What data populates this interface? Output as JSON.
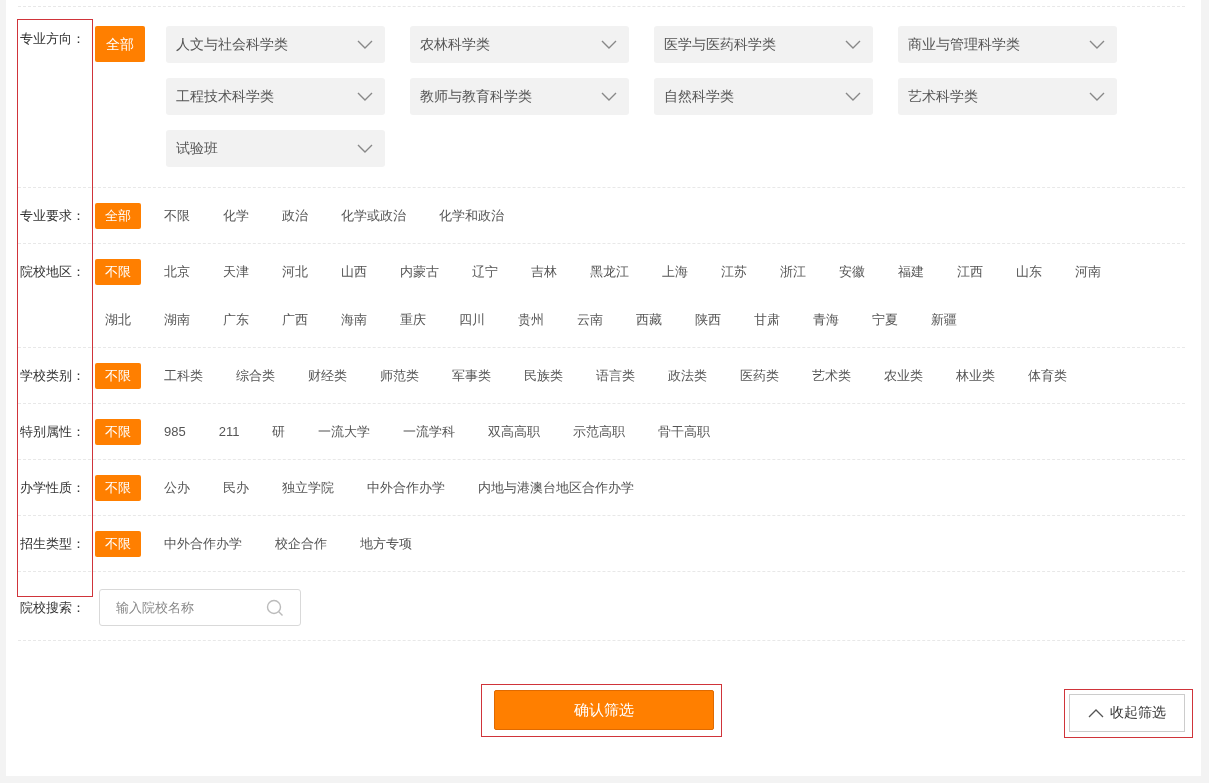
{
  "filters": [
    {
      "label": "专业方向：",
      "kind": "dropdowns",
      "options": [
        {
          "label": "全部",
          "selected": true
        }
      ],
      "dropdowns": [
        "人文与社会科学类",
        "农林科学类",
        "医学与医药科学类",
        "商业与管理科学类",
        "工程技术科学类",
        "教师与教育科学类",
        "自然科学类",
        "艺术科学类",
        "试验班"
      ]
    },
    {
      "label": "专业要求：",
      "kind": "chips",
      "options": [
        {
          "label": "全部",
          "selected": true
        },
        {
          "label": "不限",
          "selected": false
        },
        {
          "label": "化学",
          "selected": false
        },
        {
          "label": "政治",
          "selected": false
        },
        {
          "label": "化学或政治",
          "selected": false
        },
        {
          "label": "化学和政治",
          "selected": false
        }
      ]
    },
    {
      "label": "院校地区：",
      "kind": "chips",
      "options": [
        {
          "label": "不限",
          "selected": true
        },
        {
          "label": "北京",
          "selected": false
        },
        {
          "label": "天津",
          "selected": false
        },
        {
          "label": "河北",
          "selected": false
        },
        {
          "label": "山西",
          "selected": false
        },
        {
          "label": "内蒙古",
          "selected": false
        },
        {
          "label": "辽宁",
          "selected": false
        },
        {
          "label": "吉林",
          "selected": false
        },
        {
          "label": "黑龙江",
          "selected": false
        },
        {
          "label": "上海",
          "selected": false
        },
        {
          "label": "江苏",
          "selected": false
        },
        {
          "label": "浙江",
          "selected": false
        },
        {
          "label": "安徽",
          "selected": false
        },
        {
          "label": "福建",
          "selected": false
        },
        {
          "label": "江西",
          "selected": false
        },
        {
          "label": "山东",
          "selected": false
        },
        {
          "label": "河南",
          "selected": false
        },
        {
          "label": "湖北",
          "selected": false
        },
        {
          "label": "湖南",
          "selected": false
        },
        {
          "label": "广东",
          "selected": false
        },
        {
          "label": "广西",
          "selected": false
        },
        {
          "label": "海南",
          "selected": false
        },
        {
          "label": "重庆",
          "selected": false
        },
        {
          "label": "四川",
          "selected": false
        },
        {
          "label": "贵州",
          "selected": false
        },
        {
          "label": "云南",
          "selected": false
        },
        {
          "label": "西藏",
          "selected": false
        },
        {
          "label": "陕西",
          "selected": false
        },
        {
          "label": "甘肃",
          "selected": false
        },
        {
          "label": "青海",
          "selected": false
        },
        {
          "label": "宁夏",
          "selected": false
        },
        {
          "label": "新疆",
          "selected": false
        }
      ]
    },
    {
      "label": "学校类别：",
      "kind": "chips",
      "options": [
        {
          "label": "不限",
          "selected": true
        },
        {
          "label": "工科类",
          "selected": false
        },
        {
          "label": "综合类",
          "selected": false
        },
        {
          "label": "财经类",
          "selected": false
        },
        {
          "label": "师范类",
          "selected": false
        },
        {
          "label": "军事类",
          "selected": false
        },
        {
          "label": "民族类",
          "selected": false
        },
        {
          "label": "语言类",
          "selected": false
        },
        {
          "label": "政法类",
          "selected": false
        },
        {
          "label": "医药类",
          "selected": false
        },
        {
          "label": "艺术类",
          "selected": false
        },
        {
          "label": "农业类",
          "selected": false
        },
        {
          "label": "林业类",
          "selected": false
        },
        {
          "label": "体育类",
          "selected": false
        }
      ]
    },
    {
      "label": "特别属性：",
      "kind": "chips",
      "options": [
        {
          "label": "不限",
          "selected": true
        },
        {
          "label": "985",
          "selected": false
        },
        {
          "label": "211",
          "selected": false
        },
        {
          "label": "研",
          "selected": false
        },
        {
          "label": "一流大学",
          "selected": false
        },
        {
          "label": "一流学科",
          "selected": false
        },
        {
          "label": "双高高职",
          "selected": false
        },
        {
          "label": "示范高职",
          "selected": false
        },
        {
          "label": "骨干高职",
          "selected": false
        }
      ]
    },
    {
      "label": "办学性质：",
      "kind": "chips",
      "options": [
        {
          "label": "不限",
          "selected": true
        },
        {
          "label": "公办",
          "selected": false
        },
        {
          "label": "民办",
          "selected": false
        },
        {
          "label": "独立学院",
          "selected": false
        },
        {
          "label": "中外合作办学",
          "selected": false
        },
        {
          "label": "内地与港澳台地区合作办学",
          "selected": false
        }
      ]
    },
    {
      "label": "招生类型：",
      "kind": "chips",
      "options": [
        {
          "label": "不限",
          "selected": true
        },
        {
          "label": "中外合作办学",
          "selected": false
        },
        {
          "label": "校企合作",
          "selected": false
        },
        {
          "label": "地方专项",
          "selected": false
        }
      ]
    }
  ],
  "search": {
    "label": "院校搜索：",
    "placeholder": "输入院校名称"
  },
  "confirm_button": "确认筛选",
  "collapse_button": "收起筛选"
}
